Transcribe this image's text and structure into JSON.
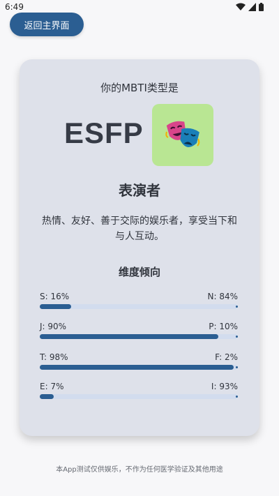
{
  "status_bar": {
    "time": "6:49"
  },
  "header": {
    "back_label": "返回主界面"
  },
  "card": {
    "subtitle": "你的MBTI类型是",
    "type_code": "ESFP",
    "type_icon": "performing-arts-masks-icon",
    "type_name": "表演者",
    "description": "热情、友好、善于交际的娱乐者，享受当下和与人互动。",
    "dimensions_title": "维度倾向",
    "dimensions": [
      {
        "left_label": "S: 16%",
        "right_label": "N: 84%",
        "fill_percent": 16
      },
      {
        "left_label": "J: 90%",
        "right_label": "P: 10%",
        "fill_percent": 90
      },
      {
        "left_label": "T: 98%",
        "right_label": "F: 2%",
        "fill_percent": 98
      },
      {
        "left_label": "E: 7%",
        "right_label": "I: 93%",
        "fill_percent": 7
      }
    ]
  },
  "footer": {
    "disclaimer": "本App测试仅供娱乐，不作为任何医学验证及其他用途"
  },
  "colors": {
    "accent": "#2b5e92",
    "card_bg": "#dee1ea",
    "track": "#d2dcee",
    "icon_bg": "#b9e693"
  }
}
